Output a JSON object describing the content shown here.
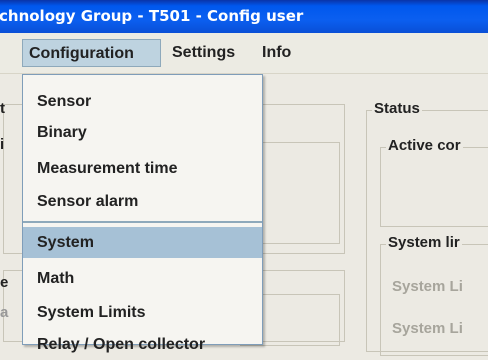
{
  "window": {
    "title": "chnology Group - T501 - Config user"
  },
  "menubar": {
    "items": [
      {
        "label": "Configuration"
      },
      {
        "label": "Settings"
      },
      {
        "label": "Info"
      }
    ]
  },
  "dropdown": {
    "items": [
      {
        "label": "Sensor"
      },
      {
        "label": "Binary"
      },
      {
        "label": "Measurement time"
      },
      {
        "label": "Sensor alarm"
      },
      {
        "label": "System",
        "selected": true
      },
      {
        "label": "Math"
      },
      {
        "label": "System Limits"
      },
      {
        "label": "Relay / Open collector"
      }
    ]
  },
  "panels": {
    "status": {
      "label": "Status"
    },
    "active_config": {
      "label": "Active cor"
    },
    "system_limits": {
      "label": "System lir"
    },
    "disabled_fields": [
      {
        "label": "System Li"
      },
      {
        "label": "System Li"
      }
    ]
  },
  "left_edge": {
    "chars": [
      "t",
      "i",
      "e",
      "a"
    ]
  },
  "colors": {
    "titlebar": "#0b5ff0",
    "menu_active": "#bed3e0",
    "item_selected": "#a6c1d6"
  }
}
